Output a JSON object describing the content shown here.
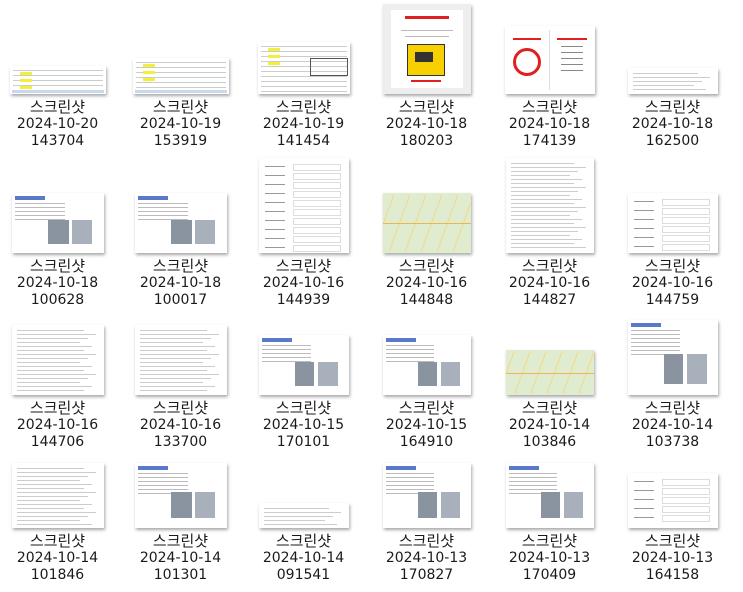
{
  "items": [
    {
      "name": "스크린샷",
      "date": "2024-10-20",
      "time": "143704"
    },
    {
      "name": "스크린샷",
      "date": "2024-10-19",
      "time": "153919"
    },
    {
      "name": "스크린샷",
      "date": "2024-10-19",
      "time": "141454"
    },
    {
      "name": "스크린샷",
      "date": "2024-10-18",
      "time": "180203"
    },
    {
      "name": "스크린샷",
      "date": "2024-10-18",
      "time": "174139"
    },
    {
      "name": "스크린샷",
      "date": "2024-10-18",
      "time": "162500"
    },
    {
      "name": "스크린샷",
      "date": "2024-10-18",
      "time": "100628"
    },
    {
      "name": "스크린샷",
      "date": "2024-10-18",
      "time": "100017"
    },
    {
      "name": "스크린샷",
      "date": "2024-10-16",
      "time": "144939"
    },
    {
      "name": "스크린샷",
      "date": "2024-10-16",
      "time": "144848"
    },
    {
      "name": "스크린샷",
      "date": "2024-10-16",
      "time": "144827"
    },
    {
      "name": "스크린샷",
      "date": "2024-10-16",
      "time": "144759"
    },
    {
      "name": "스크린샷",
      "date": "2024-10-16",
      "time": "144706"
    },
    {
      "name": "스크린샷",
      "date": "2024-10-16",
      "time": "133700"
    },
    {
      "name": "스크린샷",
      "date": "2024-10-15",
      "time": "170101"
    },
    {
      "name": "스크린샷",
      "date": "2024-10-15",
      "time": "164910"
    },
    {
      "name": "스크린샷",
      "date": "2024-10-14",
      "time": "103846"
    },
    {
      "name": "스크린샷",
      "date": "2024-10-14",
      "time": "103738"
    },
    {
      "name": "스크린샷",
      "date": "2024-10-14",
      "time": "101846"
    },
    {
      "name": "스크린샷",
      "date": "2024-10-14",
      "time": "101301"
    },
    {
      "name": "스크린샷",
      "date": "2024-10-14",
      "time": "091541"
    },
    {
      "name": "스크린샷",
      "date": "2024-10-13",
      "time": "170827"
    },
    {
      "name": "스크린샷",
      "date": "2024-10-13",
      "time": "170409"
    },
    {
      "name": "스크린샷",
      "date": "2024-10-13",
      "time": "164158"
    }
  ],
  "colors": {
    "highlight": "#f4ef3a",
    "sign_red": "#e02020",
    "cctv_yellow": "#f7d000",
    "map_green": "#dfeccf"
  }
}
